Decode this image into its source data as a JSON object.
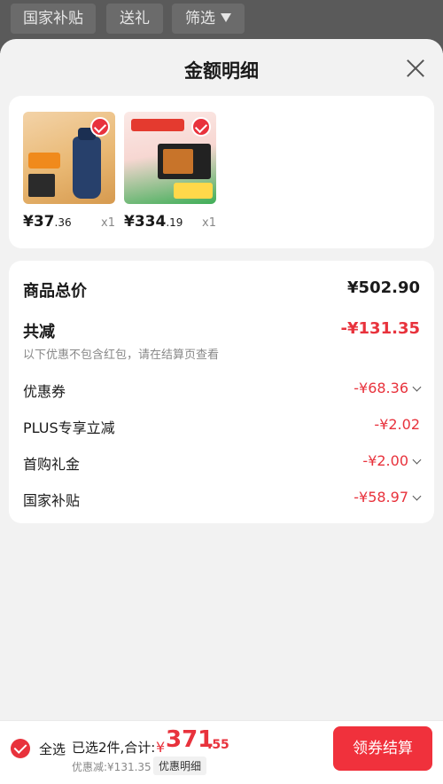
{
  "filters": [
    {
      "label": "国家补贴"
    },
    {
      "label": "送礼"
    },
    {
      "label": "筛选"
    }
  ],
  "sheet": {
    "title": "金额明细"
  },
  "products": [
    {
      "price_int": "¥37",
      "price_dec": ".36",
      "qty": "x1",
      "selected": true
    },
    {
      "price_int": "¥334",
      "price_dec": ".19",
      "qty": "x1",
      "selected": true
    }
  ],
  "summary": {
    "total_label": "商品总价",
    "total_value": "¥502.90",
    "reduce_label": "共减",
    "reduce_value": "-¥131.35",
    "note": "以下优惠不包含红包，请在结算页查看",
    "items": [
      {
        "label": "优惠券",
        "value": "-¥68.36",
        "expandable": true
      },
      {
        "label": "PLUS专享立减",
        "value": "-¥2.02",
        "expandable": false
      },
      {
        "label": "首购礼金",
        "value": "-¥2.00",
        "expandable": true
      },
      {
        "label": "国家补贴",
        "value": "-¥58.97",
        "expandable": true
      }
    ]
  },
  "bottom": {
    "select_all": "全选",
    "selected_text": "已选2件,合计:",
    "currency": "¥",
    "total_int": "371",
    "total_dec": ".55",
    "discount": "优惠减:¥131.35",
    "detail_link": "优惠明细",
    "checkout": "领券结算"
  },
  "colors": {
    "accent": "#e8323c",
    "page_bg": "#f2f2f2",
    "overlay_bar": "#5a5a5a"
  }
}
